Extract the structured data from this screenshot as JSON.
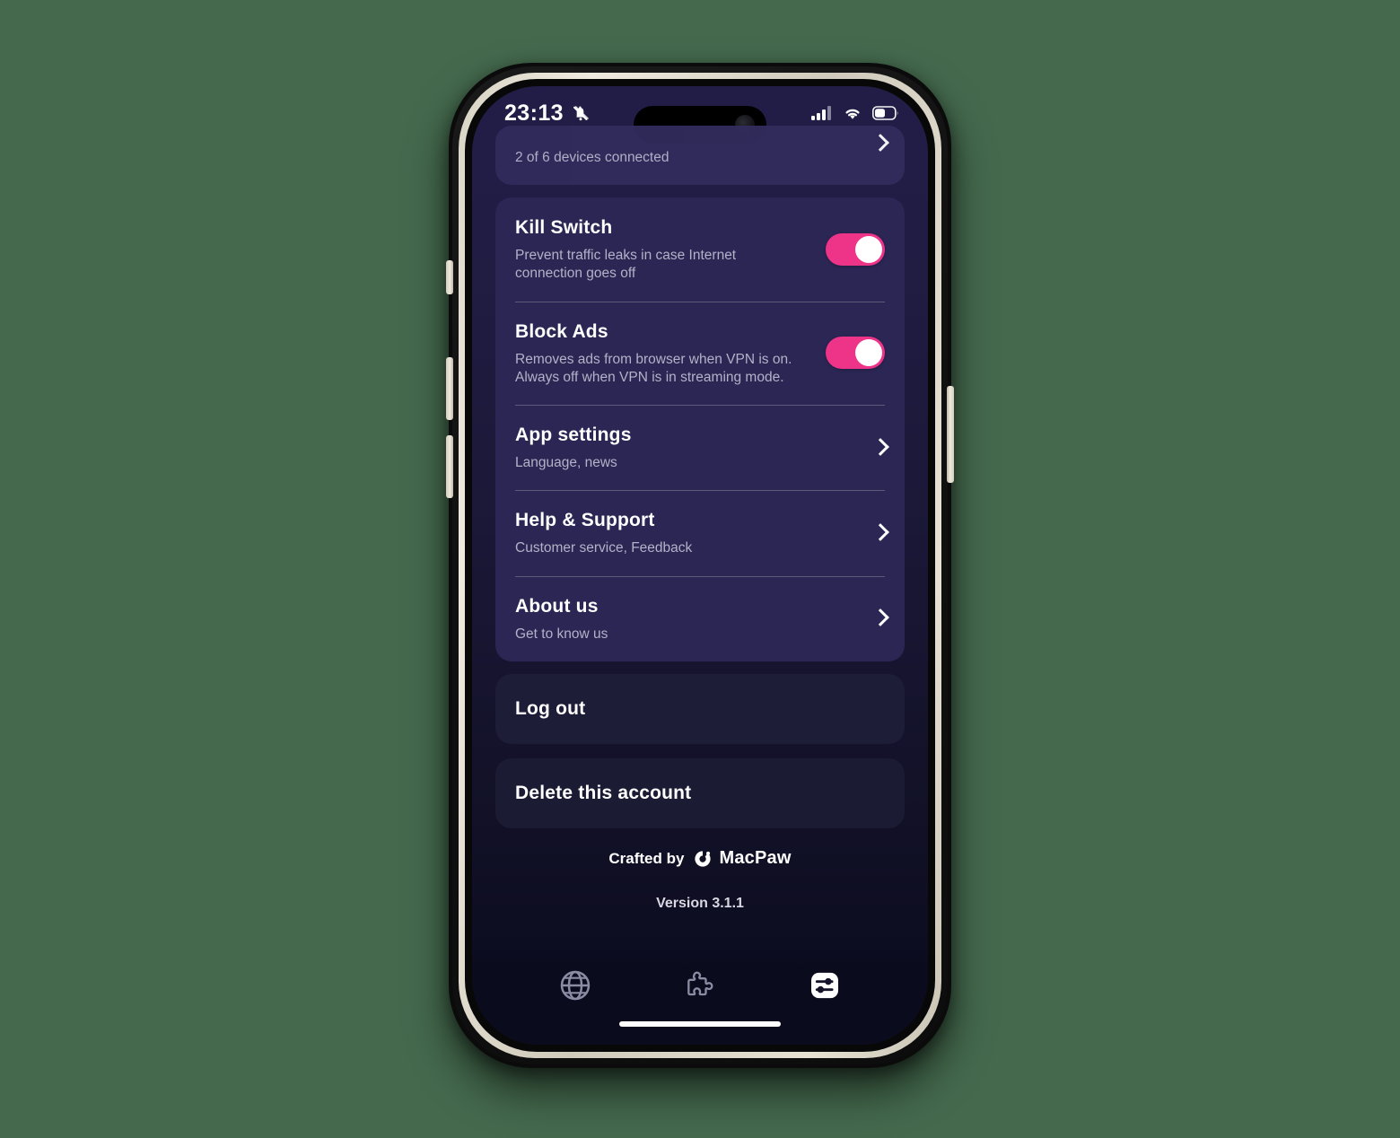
{
  "status_bar": {
    "time": "23:13",
    "silent_icon": "bell-slash-icon",
    "cellular_icon": "signal-bars-icon",
    "wifi_icon": "wifi-icon",
    "battery_icon": "battery-icon"
  },
  "top_partial_card": {
    "subtitle": "2 of 6 devices connected",
    "chevron": "chevron-right-icon"
  },
  "settings_card": {
    "rows": [
      {
        "title": "Kill Switch",
        "subtitle": "Prevent traffic leaks in case Internet connection goes off",
        "control": "toggle",
        "toggle_on": true
      },
      {
        "title": "Block Ads",
        "subtitle": "Removes ads from browser when VPN is on. Always off when VPN is in streaming mode.",
        "control": "toggle",
        "toggle_on": true
      },
      {
        "title": "App settings",
        "subtitle": "Language, news",
        "control": "chevron"
      },
      {
        "title": "Help & Support",
        "subtitle": "Customer service, Feedback",
        "control": "chevron"
      },
      {
        "title": "About us",
        "subtitle": "Get to know us",
        "control": "chevron"
      }
    ]
  },
  "actions": {
    "log_out": "Log out",
    "delete_account": "Delete this account"
  },
  "footer": {
    "crafted_by": "Crafted by",
    "brand": "MacPaw",
    "version": "Version 3.1.1"
  },
  "tab_bar": {
    "tabs": [
      {
        "name": "globe-icon",
        "active": false
      },
      {
        "name": "puzzle-icon",
        "active": false
      },
      {
        "name": "settings-sliders-icon",
        "active": true
      }
    ]
  },
  "colors": {
    "accent_pink": "#ee3489",
    "card_bg": "#2b2654",
    "action_card_bg": "#1d1d38",
    "screen_top": "#221d46",
    "screen_bottom": "#0b0b1e"
  }
}
